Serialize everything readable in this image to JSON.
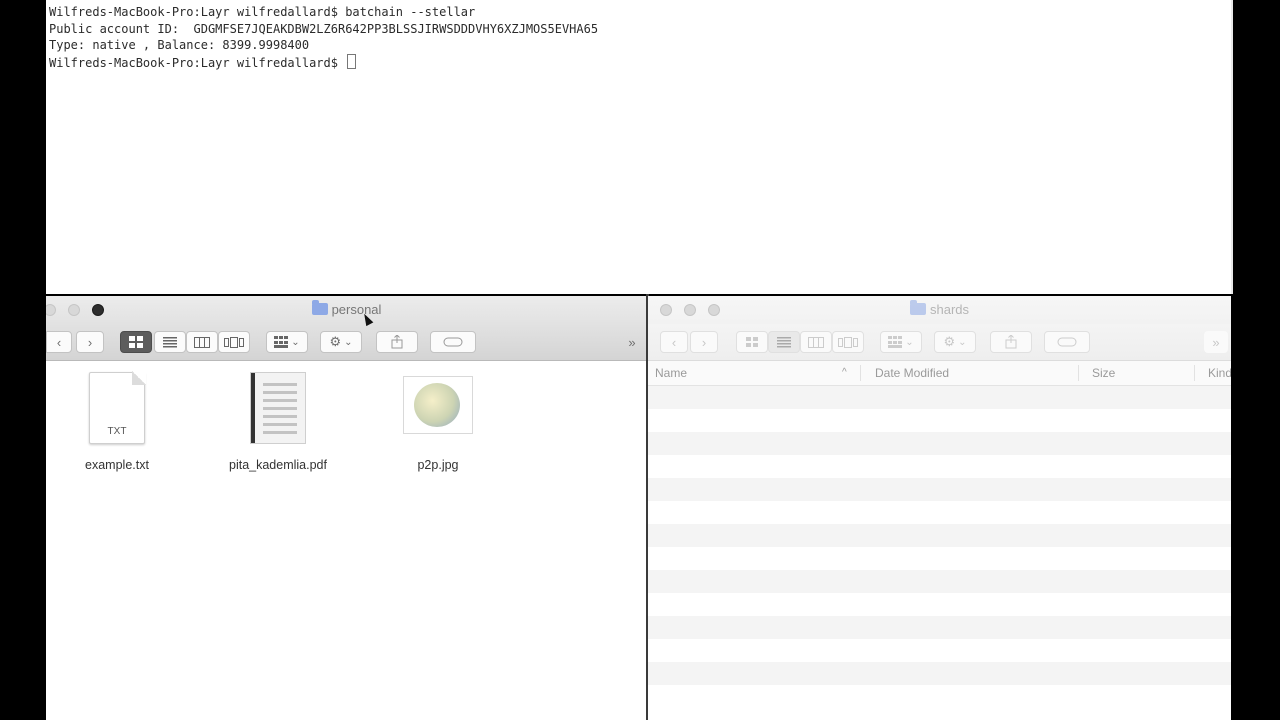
{
  "terminal": {
    "lines": [
      "Wilfreds-MacBook-Pro:Layr wilfredallard$ batchain --stellar",
      "Public account ID:  GDGMFSE7JQEAKDBW2LZ6R642PP3BLSSJIRWSDDDVHY6XZJMOS5EVHA65",
      "Type: native , Balance: 8399.9998400",
      "Wilfreds-MacBook-Pro:Layr wilfredallard$ "
    ]
  },
  "finder_personal": {
    "title": "personal",
    "view_mode": "icons",
    "files": [
      {
        "name": "example.txt",
        "icon": "txt-document-icon",
        "badge": "TXT"
      },
      {
        "name": "pita_kademlia.pdf",
        "icon": "pdf-document-icon"
      },
      {
        "name": "p2p.jpg",
        "icon": "image-thumbnail-icon"
      }
    ]
  },
  "finder_shards": {
    "title": "shards",
    "view_mode": "list",
    "columns": [
      "Name",
      "Date Modified",
      "Size",
      "Kind"
    ],
    "sort_indicator": "^"
  },
  "toolbar": {
    "back": "‹",
    "forward": "›",
    "action": "⚙",
    "dropdown_caret": "⌄",
    "overflow": "»"
  },
  "colors": {
    "terminal_bg": "#ffffff",
    "active_view_button": "#5d5d5d",
    "folder": "#8ea9e6",
    "row_alt": "#f4f4f4"
  }
}
